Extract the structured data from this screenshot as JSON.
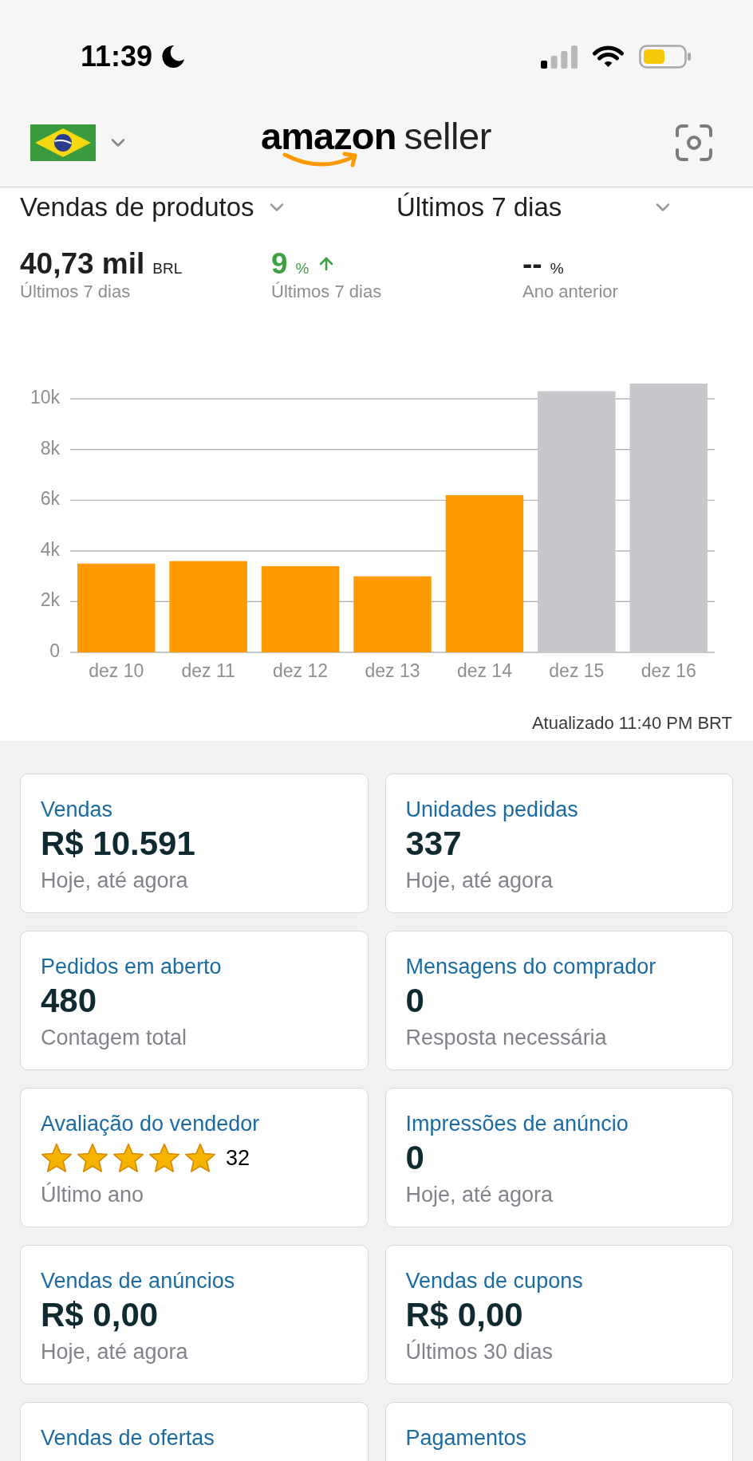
{
  "status_bar": {
    "time": "11:39"
  },
  "header": {
    "logo": {
      "brand": "amazon",
      "product": "seller"
    }
  },
  "report": {
    "metric_selector": "Vendas de produtos",
    "period_selector": "Últimos 7 dias",
    "stats": [
      {
        "value": "40,73 mil",
        "unit": "BRL",
        "caption": "Últimos 7 dias",
        "rising": false
      },
      {
        "value": "9",
        "unit": "%",
        "caption": "Últimos 7 dias",
        "rising": true
      },
      {
        "value": "--",
        "unit": "%",
        "caption": "Ano anterior",
        "rising": false
      }
    ],
    "chart_data": {
      "type": "bar",
      "categories": [
        "dez 10",
        "dez 11",
        "dez 12",
        "dez 13",
        "dez 14",
        "dez 15",
        "dez 16"
      ],
      "series": [
        {
          "color": "#ff9a00",
          "values": [
            3500,
            3600,
            3400,
            3000,
            6200,
            null,
            null
          ]
        },
        {
          "color": "#c7c7cc",
          "values": [
            null,
            null,
            null,
            null,
            null,
            10300,
            10600
          ]
        }
      ],
      "grid": true,
      "ylim": [
        0,
        10600
      ],
      "yticks": [
        {
          "value": 0,
          "label": "0"
        },
        {
          "value": 2000,
          "label": "2k"
        },
        {
          "value": 4000,
          "label": "4k"
        },
        {
          "value": 6000,
          "label": "6k"
        },
        {
          "value": 8000,
          "label": "8k"
        },
        {
          "value": 10000,
          "label": "10k"
        }
      ]
    },
    "updated": "Atualizado 11:40 PM BRT"
  },
  "cards": [
    {
      "kind": "value",
      "title": "Vendas",
      "value": "R$ 10.591",
      "caption": "Hoje, até agora"
    },
    {
      "kind": "value",
      "title": "Unidades pedidas",
      "value": "337",
      "caption": "Hoje, até agora"
    },
    {
      "kind": "value",
      "title": "Pedidos em aberto",
      "value": "480",
      "caption": "Contagem total"
    },
    {
      "kind": "value",
      "title": "Mensagens do comprador",
      "value": "0",
      "caption": "Resposta necessária"
    },
    {
      "kind": "rating",
      "title": "Avaliação do vendedor",
      "stars": 5,
      "count": "32",
      "caption": "Último ano"
    },
    {
      "kind": "value",
      "title": "Impressões de anúncio",
      "value": "0",
      "caption": "Hoje, até agora"
    },
    {
      "kind": "value",
      "title": "Vendas de anúncios",
      "value": "R$ 0,00",
      "caption": "Hoje, até agora"
    },
    {
      "kind": "value",
      "title": "Vendas de cupons",
      "value": "R$ 0,00",
      "caption": "Últimos 30 dias"
    },
    {
      "kind": "value",
      "title": "Vendas de ofertas"
    },
    {
      "kind": "value",
      "title": "Pagamentos"
    }
  ]
}
